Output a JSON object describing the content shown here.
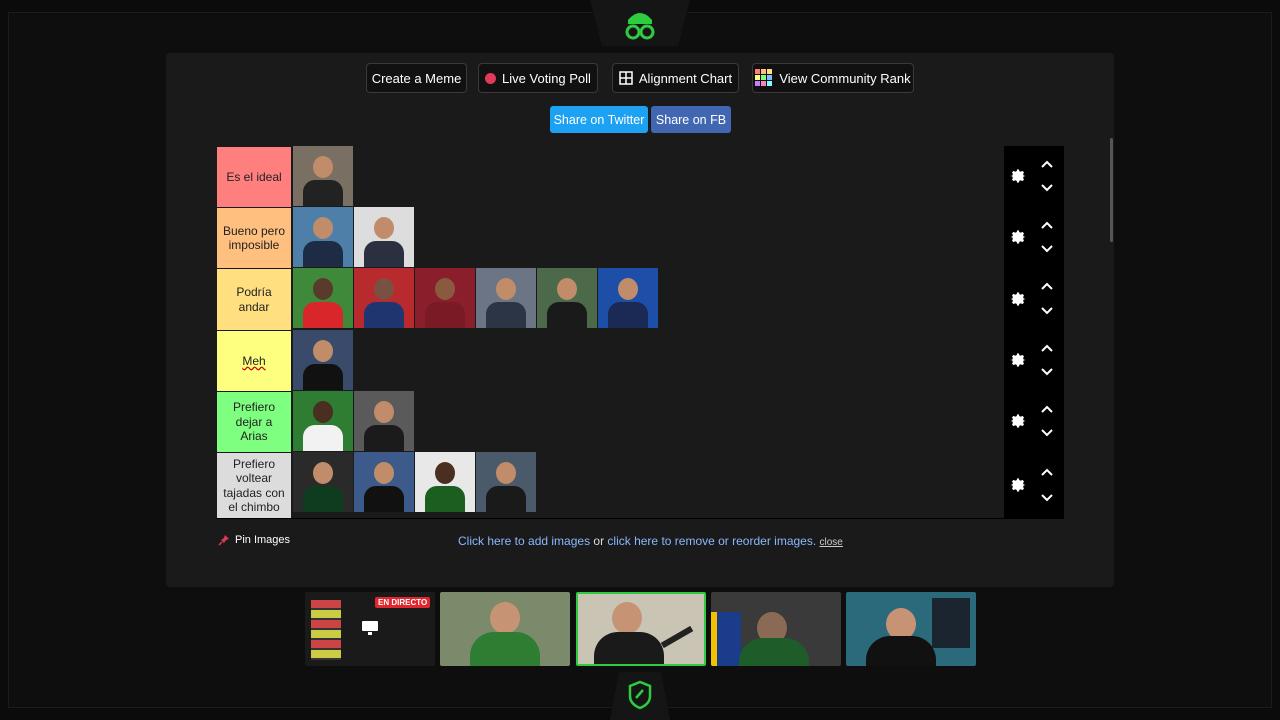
{
  "top_buttons": {
    "create_meme": "Create a Meme",
    "live_poll": "Live Voting Poll",
    "alignment_chart": "Alignment Chart",
    "community_rank": "View Community Rank"
  },
  "share": {
    "twitter": "Share on Twitter",
    "fb": "Share on FB"
  },
  "tiers": [
    {
      "label": "Es el ideal",
      "color": "#ff7f7f",
      "items": 1
    },
    {
      "label": "Bueno pero imposible",
      "color": "#ffbf7f",
      "items": 2
    },
    {
      "label": "Podría andar",
      "color": "#ffdf7f",
      "items": 6
    },
    {
      "label": "Meh",
      "color": "#ffff7f",
      "items": 1
    },
    {
      "label": "Prefiero dejar a Arias",
      "color": "#7fff7f",
      "items": 2
    },
    {
      "label": "Prefiero voltear tajadas con el chimbo",
      "color": "#dcdcdc",
      "items": 4
    }
  ],
  "footer": {
    "pin": "Pin Images",
    "add_images": "Click here to add images",
    "or": " or ",
    "reorder": "click here to remove or reorder images.",
    "close": "close"
  },
  "stream": {
    "live_badge": "EN DIRECTO"
  },
  "colors": {
    "twitter": "#1da1f2",
    "fb": "#4267b2",
    "accent": "#2ecc40"
  }
}
